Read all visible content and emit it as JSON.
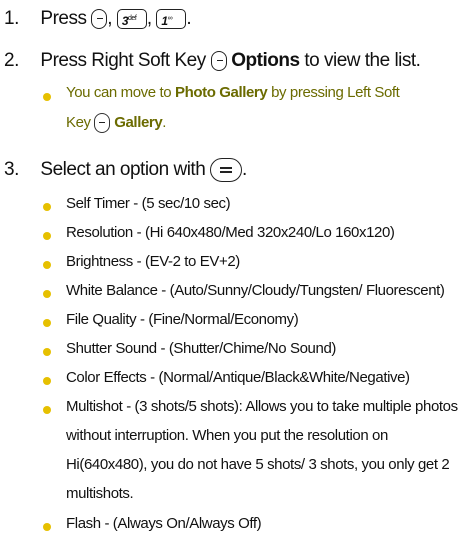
{
  "step1": {
    "num": "1.",
    "text": "Press",
    "key_3": "3",
    "key_3_sub": "def",
    "key_1": "1",
    "key_1_sub": "∞",
    "sep1": ",",
    "sep2": ",",
    "end": "."
  },
  "step2": {
    "num": "2.",
    "pre": "Press Right Soft Key",
    "bold": "Options",
    "post": "to view the list.",
    "note_pre": "You can move to",
    "note_bold": "Photo Gallery",
    "note_mid": "by pressing Left Soft",
    "note_line2_pre": "Key",
    "note_line2_bold": "Gallery",
    "note_line2_end": "."
  },
  "step3": {
    "num": "3.",
    "text": "Select an option with",
    "end": "."
  },
  "options": [
    "Self Timer - (5 sec/10 sec)",
    "Resolution - (Hi 640x480/Med 320x240/Lo 160x120)",
    "Brightness - (EV-2 to EV+2)",
    "White Balance - (Auto/Sunny/Cloudy/Tungsten/ Fluorescent)",
    "File Quality - (Fine/Normal/Economy)",
    "Shutter Sound - (Shutter/Chime/No Sound)",
    "Color Effects - (Normal/Antique/Black&White/Negative)"
  ],
  "multishot": [
    "Multishot - (3 shots/5 shots): Allows you to take multiple photos",
    "without interruption. When you put the resolution on",
    "Hi(640x480), you do not have 5 shots/ 3 shots, you only get 2",
    "multishots."
  ],
  "flash": "Flash - (Always On/Always Off)",
  "colors": {
    "bullet": "#e6c000",
    "note_text": "#6b6b00"
  }
}
